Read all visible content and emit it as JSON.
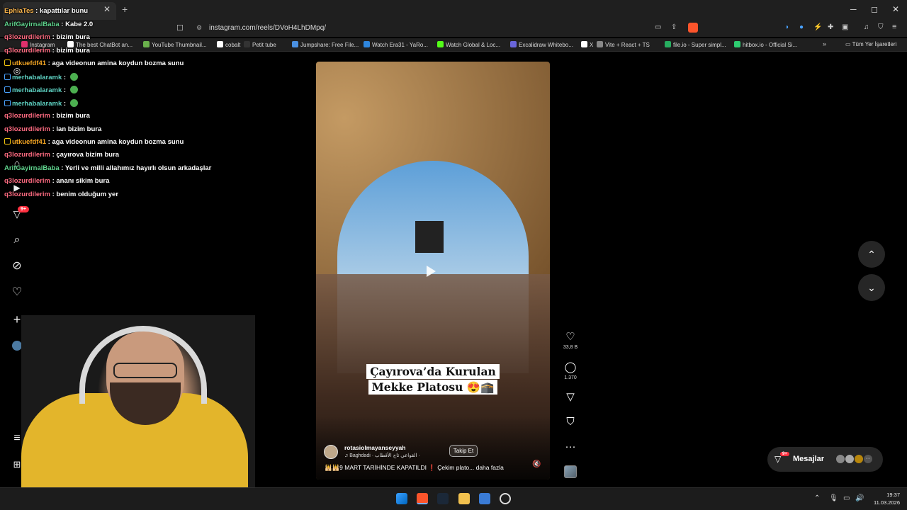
{
  "browser": {
    "tab_title": "Instagram",
    "new_tab": "+",
    "tab_close": "✕",
    "url": "instagram.com/reels/DVoH4LhDMpq/",
    "window_controls": [
      "─",
      "◻",
      "✕"
    ],
    "bookmarks": [
      {
        "label": "Instagram",
        "color": "#e1306c"
      },
      {
        "label": "The best ChatBot an...",
        "color": "#ffffff"
      },
      {
        "label": "YouTube Thumbnail...",
        "color": "#6ab04c"
      },
      {
        "label": "cobalt",
        "color": "#ffffff"
      },
      {
        "label": "Petit tube",
        "color": "#333333"
      },
      {
        "label": "Jumpshare: Free File...",
        "color": "#4a90e2"
      },
      {
        "label": "Watch Era31 - YaRo...",
        "color": "#2e86de"
      },
      {
        "label": "Watch Global & Loc...",
        "color": "#53fc18"
      },
      {
        "label": "Excalidraw Whitebo...",
        "color": "#6965db"
      },
      {
        "label": "X",
        "color": "#ffffff"
      },
      {
        "label": "Vite + React + TS",
        "color": "#888888"
      },
      {
        "label": "file.io - Super simpl...",
        "color": "#27ae60"
      },
      {
        "label": "hitbox.io - Official Si...",
        "color": "#2ecc71"
      }
    ],
    "bookmarks_more": "»",
    "all_bookmarks": "Tüm Yer İşaretleri"
  },
  "chat": [
    {
      "user": "EphiaTes",
      "user_color": "#ffb84d",
      "text": "kapattılar bunu",
      "badge": ""
    },
    {
      "user": "ArifGayirnalBaba",
      "user_color": "#5fd38d",
      "text": "Kabe 2.0",
      "badge": ""
    },
    {
      "user": "q3lozurdilerim",
      "user_color": "#ff6b81",
      "text": "bizim bura",
      "badge": ""
    },
    {
      "user": "q3lozurdilerim",
      "user_color": "#ff6b81",
      "text": "bizim bura",
      "badge": ""
    },
    {
      "user": "utkuefdf41",
      "user_color": "#f5a623",
      "text": "aga videonun amina koydun bozma sunu",
      "badge": "y"
    },
    {
      "user": "merhabalaramk",
      "user_color": "#5fd3c4",
      "text": "",
      "badge": "b",
      "emote": true
    },
    {
      "user": "merhabalaramk",
      "user_color": "#5fd3c4",
      "text": "",
      "badge": "b",
      "emote": true
    },
    {
      "user": "merhabalaramk",
      "user_color": "#5fd3c4",
      "text": "",
      "badge": "b",
      "emote": true
    },
    {
      "user": "q3lozurdilerim",
      "user_color": "#ff6b81",
      "text": "bizim bura",
      "badge": ""
    },
    {
      "user": "q3lozurdilerim",
      "user_color": "#ff6b81",
      "text": "lan bizim bura",
      "badge": ""
    },
    {
      "user": "utkuefdf41",
      "user_color": "#f5a623",
      "text": "aga videonun amina koydun bozma sunu",
      "badge": "y"
    },
    {
      "user": "q3lozurdilerim",
      "user_color": "#ff6b81",
      "text": "çayırova bizim bura",
      "badge": ""
    },
    {
      "user": "ArifGayirnalBaba",
      "user_color": "#5fd38d",
      "text": "Yerli ve milli allahımız hayırlı olsun arkadaşlar",
      "badge": ""
    },
    {
      "user": "q3lozurdilerim",
      "user_color": "#ff6b81",
      "text": "ananı sikim bura",
      "badge": ""
    },
    {
      "user": "q3lozurdilerim",
      "user_color": "#ff6b81",
      "text": "benim olduğum yer",
      "badge": ""
    }
  ],
  "sidebar": {
    "notif_count": "9+"
  },
  "reel": {
    "overlay_line1": "Çayırova’da Kurulan",
    "overlay_line2": "Mekke Platosu 😍🕋",
    "username": "rotasiolmayanseyyah",
    "follow": "Takip Et",
    "music": "♫  Baghdadi · القواعي تاج الأقطاب ·",
    "caption": "🕌🕌9 MART TARİHİNDE KAPATILDI ❗️ Çekim plato... daha fazla",
    "likes": "33,8 B",
    "comments": "1.370"
  },
  "messages": {
    "label": "Mesajlar",
    "badge": "9+"
  },
  "taskbar": {
    "time": "19:37",
    "date": "11.03.2026"
  }
}
